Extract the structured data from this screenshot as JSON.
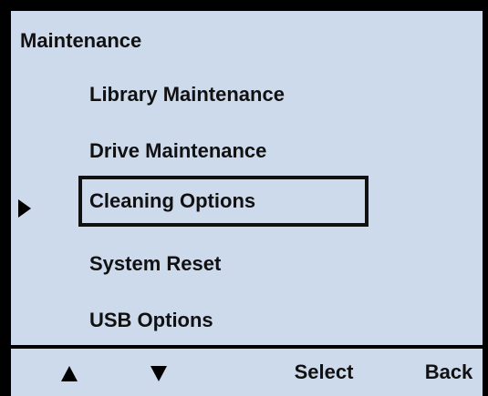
{
  "screen": {
    "title": "Maintenance",
    "background_color": "#cddaec",
    "menu": {
      "selected_index": 2,
      "items": [
        {
          "label": "Library Maintenance"
        },
        {
          "label": "Drive Maintenance"
        },
        {
          "label": "Cleaning Options"
        },
        {
          "label": "System Reset"
        },
        {
          "label": "USB Options"
        }
      ]
    },
    "softkeys": {
      "up_icon": "triangle-up-icon",
      "down_icon": "triangle-down-icon",
      "select_label": "Select",
      "back_label": "Back"
    }
  }
}
